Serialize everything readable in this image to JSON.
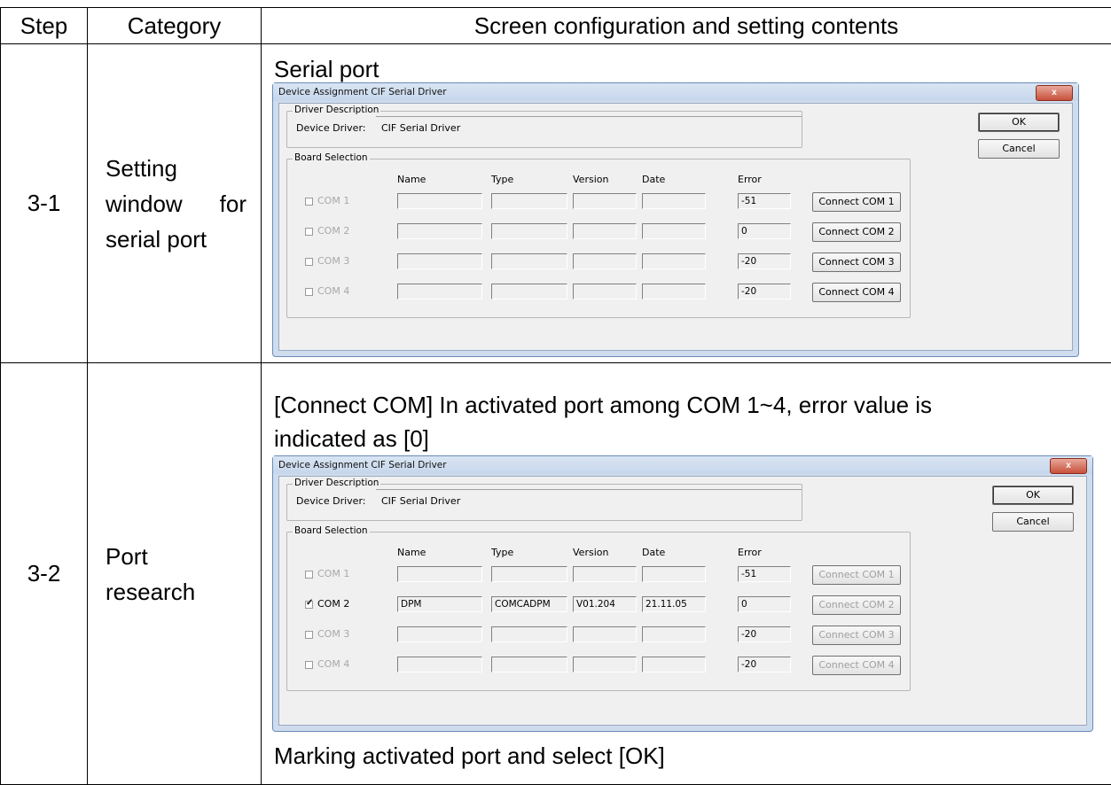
{
  "header": {
    "step": "Step",
    "category": "Category",
    "content": "Screen configuration and setting contents"
  },
  "rows": [
    {
      "step": "3-1",
      "category_lines": [
        [
          "Setting"
        ],
        [
          "window",
          "for"
        ],
        [
          "serial port"
        ]
      ],
      "content_title": "Serial port",
      "dialog": {
        "title": "Device Assignment CIF Serial Driver",
        "close": "x",
        "driver_description": "Driver Description",
        "device_driver_label": "Device Driver:",
        "device_driver_value": "CIF Serial Driver",
        "ok": "OK",
        "cancel": "Cancel",
        "board_selection": "Board Selection",
        "columns": [
          "Name",
          "Type",
          "Version",
          "Date",
          "Error"
        ],
        "ports": [
          {
            "label": "COM 1",
            "checked": false,
            "name": "",
            "type": "",
            "version": "",
            "date": "",
            "error": "-51",
            "button": "Connect COM 1",
            "button_disabled": false
          },
          {
            "label": "COM 2",
            "checked": false,
            "name": "",
            "type": "",
            "version": "",
            "date": "",
            "error": "0",
            "button": "Connect COM 2",
            "button_disabled": false
          },
          {
            "label": "COM 3",
            "checked": false,
            "name": "",
            "type": "",
            "version": "",
            "date": "",
            "error": "-20",
            "button": "Connect COM 3",
            "button_disabled": false
          },
          {
            "label": "COM 4",
            "checked": false,
            "name": "",
            "type": "",
            "version": "",
            "date": "",
            "error": "-20",
            "button": "Connect COM 4",
            "button_disabled": false
          }
        ]
      }
    },
    {
      "step": "3-2",
      "category_lines": [
        [
          "Port"
        ],
        [
          "research"
        ]
      ],
      "content_title": "[Connect COM] In activated port among COM 1~4, error value is",
      "content_title_2": "indicated as [0]",
      "dialog": {
        "title": "Device Assignment CIF Serial Driver",
        "close": "x",
        "driver_description": "Driver Description",
        "device_driver_label": "Device Driver:",
        "device_driver_value": "CIF Serial Driver",
        "ok": "OK",
        "cancel": "Cancel",
        "board_selection": "Board Selection",
        "columns": [
          "Name",
          "Type",
          "Version",
          "Date",
          "Error"
        ],
        "ports": [
          {
            "label": "COM 1",
            "checked": false,
            "name": "",
            "type": "",
            "version": "",
            "date": "",
            "error": "-51",
            "button": "Connect COM 1",
            "button_disabled": true
          },
          {
            "label": "COM 2",
            "checked": true,
            "name": "DPM",
            "type": "COMCADPM",
            "version": "V01.204",
            "date": "21.11.05",
            "error": "0",
            "button": "Connect COM 2",
            "button_disabled": true
          },
          {
            "label": "COM 3",
            "checked": false,
            "name": "",
            "type": "",
            "version": "",
            "date": "",
            "error": "-20",
            "button": "Connect COM 3",
            "button_disabled": true
          },
          {
            "label": "COM 4",
            "checked": false,
            "name": "",
            "type": "",
            "version": "",
            "date": "",
            "error": "-20",
            "button": "Connect COM 4",
            "button_disabled": true
          }
        ]
      },
      "footer_text": "Marking activated port and select [OK]"
    }
  ]
}
